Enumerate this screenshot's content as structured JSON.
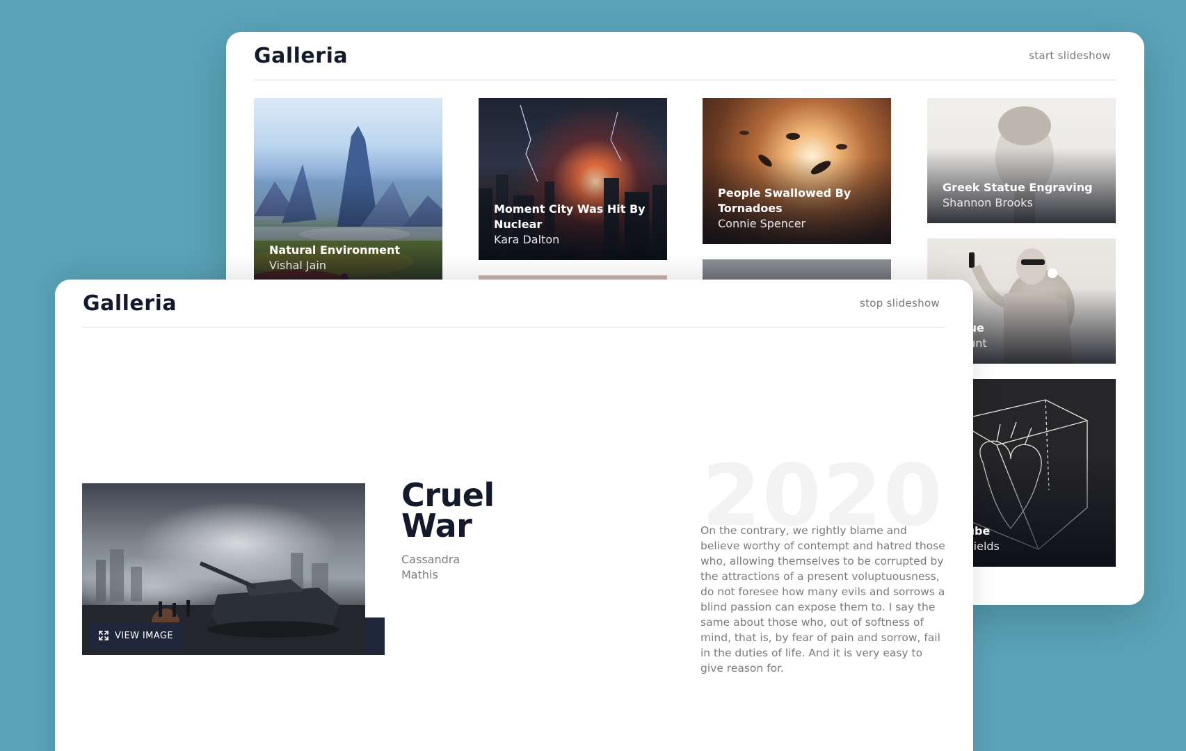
{
  "back_window": {
    "logo": "Galleria",
    "slideshow_link": "start slideshow",
    "cards": [
      {
        "title": "Natural Environment",
        "artist": "Vishal Jain",
        "art": "landscape-painting"
      },
      {
        "title": "Moment City Was Hit By Nuclear",
        "artist": "Kara Dalton",
        "art": "nuclear-city-painting"
      },
      {
        "title": "People Swallowed By Tornadoes",
        "artist": "Connie Spencer",
        "art": "tornado-painting"
      },
      {
        "title": "Greek Statue Engraving",
        "artist": "Shannon Brooks",
        "art": "greek-statue-engraving"
      },
      {
        "title": "Statue",
        "artist": "da Hunt",
        "art": "statue-with-phone"
      },
      {
        "title": "In Cube",
        "artist": "ay Shields",
        "art": "heart-in-cube-drawing"
      }
    ]
  },
  "front_window": {
    "logo": "Galleria",
    "slideshow_link": "stop slideshow",
    "artwork": {
      "title": "Cruel War",
      "artist": "Cassandra Mathis",
      "year": "2020",
      "view_button": "VIEW IMAGE",
      "image": "tank-war-painting",
      "description": "On the contrary, we rightly blame and believe worthy of contempt and hatred those who, allowing themselves to be corrupted by the attractions of a present voluptuousness, do not foresee how many evils and sorrows a blind passion can expose them to. I say the same about those who, out of softness of mind, that is, by fear of pain and sorrow, fail in the duties of life. And it is very easy to give reason for."
    }
  },
  "colors": {
    "background": "#5aa3b8",
    "dark": "#141a2b",
    "button": "#20263a",
    "muted_text": "#7b7b7b",
    "year_ghost": "#f3f3f3"
  }
}
